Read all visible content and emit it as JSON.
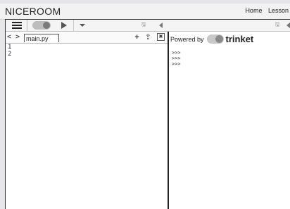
{
  "brand": "NICEROOM",
  "top_nav": [
    "Home",
    "Lesson"
  ],
  "toolbar": {
    "menu_icon": "hamburger-icon",
    "toggle_icon": "trinket-toggle-icon",
    "run_icon": "play-icon",
    "options_icon": "chevron-down-icon",
    "save_glyph": "🖫",
    "collapse_icon": "triangle-left-icon"
  },
  "editor": {
    "code_toggle_label": "< >",
    "file_tab": "main.py",
    "line_numbers": [
      "1",
      "2"
    ],
    "actions": [
      "add-icon",
      "upload-icon",
      "image-icon"
    ]
  },
  "output": {
    "powered_by": "Powered by",
    "brand_word": "trinket",
    "prompts": [
      ">>>",
      ">>>",
      ">>>"
    ]
  }
}
